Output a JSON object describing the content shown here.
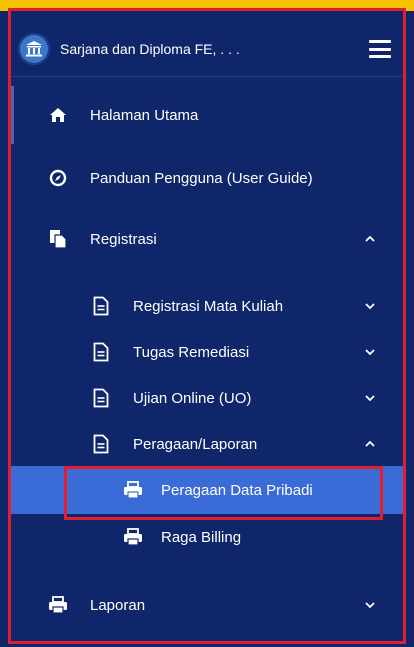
{
  "brand": {
    "title": "Sarjana dan Diploma FE, . . .",
    "logo_icon": "institution-icon",
    "menu_icon": "hamburger-icon"
  },
  "menu": {
    "home": {
      "label": "Halaman Utama",
      "icon": "home-icon"
    },
    "guide": {
      "label": "Panduan Pengguna (User Guide)",
      "icon": "compass-icon"
    },
    "registrasi": {
      "label": "Registrasi",
      "icon": "copy-document-icon",
      "state": "expanded"
    },
    "registrasi_items": [
      {
        "label": "Registrasi Mata Kuliah",
        "icon": "file-icon",
        "state": "collapsed"
      },
      {
        "label": "Tugas Remediasi",
        "icon": "file-icon",
        "state": "collapsed"
      },
      {
        "label": "Ujian Online (UO)",
        "icon": "file-icon",
        "state": "collapsed"
      },
      {
        "label": "Peragaan/Laporan",
        "icon": "file-icon",
        "state": "expanded"
      }
    ],
    "laporan_items": [
      {
        "label": "Peragaan Data Pribadi",
        "icon": "printer-icon",
        "selected": true
      },
      {
        "label": "Raga Billing",
        "icon": "printer-icon",
        "selected": false
      }
    ],
    "laporan": {
      "label": "Laporan",
      "icon": "printer-icon",
      "state": "collapsed"
    }
  },
  "colors": {
    "sidebar_bg": "#10266b",
    "selected_bg": "#3a6bd6",
    "highlight_outline": "#e11d2e",
    "top_strip": "#f5c400"
  }
}
